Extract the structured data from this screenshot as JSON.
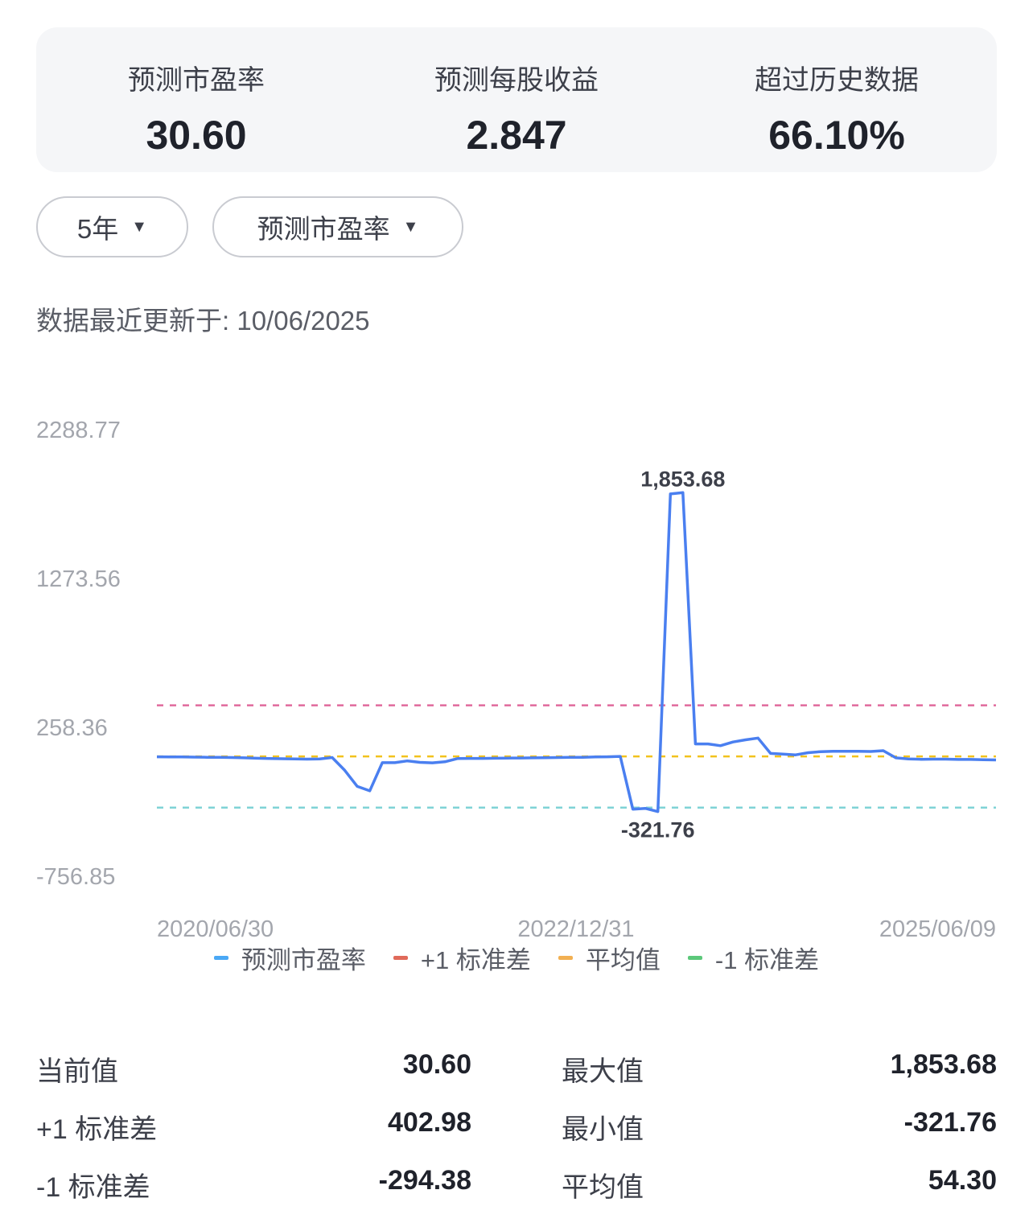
{
  "summary": [
    {
      "label": "预测市盈率",
      "value": "30.60"
    },
    {
      "label": "预测每股收益",
      "value": "2.847"
    },
    {
      "label": "超过历史数据",
      "value": "66.10%"
    }
  ],
  "filters": {
    "period": "5年",
    "metric": "预测市盈率"
  },
  "updated": "数据最近更新于: 10/06/2025",
  "legend": [
    {
      "label": "预测市盈率",
      "color": "#4aa8f5"
    },
    {
      "label": "+1 标准差",
      "color": "#e06a5a"
    },
    {
      "label": "平均值",
      "color": "#f2b052"
    },
    {
      "label": "-1 标准差",
      "color": "#5cc87a"
    }
  ],
  "chart_data": {
    "type": "line",
    "y_ticks": [
      "2288.77",
      "1273.56",
      "258.36",
      "-756.85"
    ],
    "ylim": [
      -756.85,
      2288.77
    ],
    "x_ticks": [
      "2020/06/30",
      "2022/12/31",
      "2025/06/09"
    ],
    "series": [
      {
        "name": "预测市盈率",
        "color": "#4a7ff0",
        "values": [
          52,
          51,
          51,
          50,
          49,
          48,
          47,
          45,
          42,
          40,
          39,
          38,
          36,
          38,
          47,
          -40,
          -150,
          -180,
          12,
          12,
          24,
          14,
          11,
          18,
          40,
          41,
          41,
          42,
          43,
          44,
          45,
          46,
          47,
          48,
          49,
          51,
          52,
          55,
          -305,
          -300,
          -321.76,
          1845,
          1853.68,
          140,
          140,
          128,
          153,
          168,
          180,
          75,
          70,
          65,
          80,
          87,
          90,
          90,
          90,
          88,
          94,
          45,
          38,
          35,
          36,
          36,
          34,
          34,
          32,
          30.6
        ]
      },
      {
        "name": "+1 标准差",
        "color": "#e06a9c",
        "values": [
          402.98
        ]
      },
      {
        "name": "平均值",
        "color": "#f2c21d",
        "values": [
          54.3
        ]
      },
      {
        "name": "-1 标准差",
        "color": "#7fd3d6",
        "values": [
          -294.38
        ]
      }
    ],
    "annotations": [
      {
        "label": "1,853.68",
        "value": 1853.68
      },
      {
        "label": "-321.76",
        "value": -321.76
      }
    ],
    "grid": false,
    "legend_position": "bottom"
  },
  "stats": [
    {
      "label": "当前值",
      "value": "30.60",
      "label2": "最大值",
      "value2": "1,853.68"
    },
    {
      "label": "+1 标准差",
      "value": "402.98",
      "label2": "最小值",
      "value2": "-321.76"
    },
    {
      "label": "-1 标准差",
      "value": "-294.38",
      "label2": "平均值",
      "value2": "54.30"
    }
  ]
}
